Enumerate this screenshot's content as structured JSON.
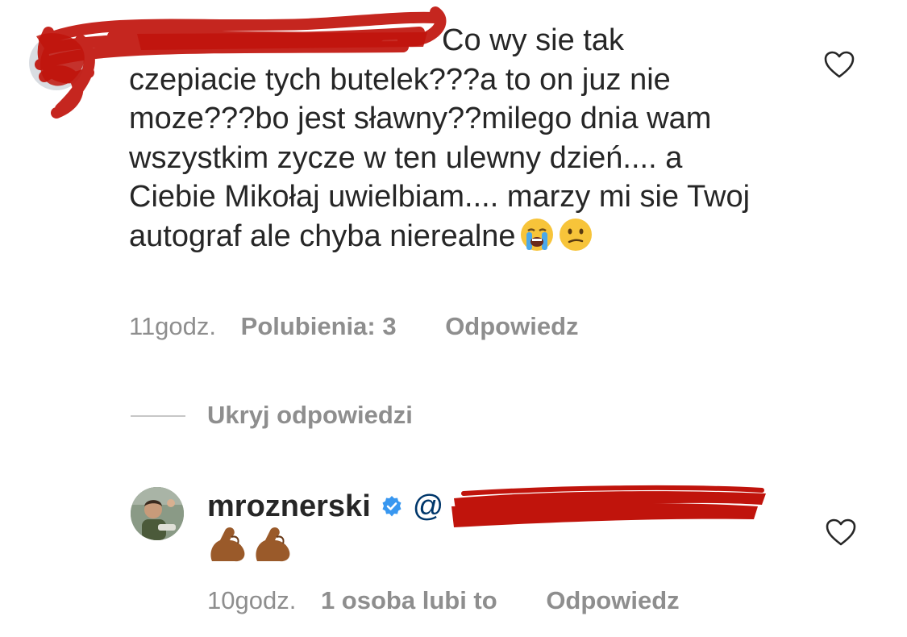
{
  "comment1": {
    "text_first_line": "Co wy sie tak",
    "text_rest": "czepiacie tych butelek???a to on juz nie moze???bo jest sławny??milego dnia wam wszystkim zycze w ten ulewny dzień.... a Ciebie Mikołaj uwielbiam.... marzy mi sie Twoj autograf ale chyba nierealne",
    "emojis": [
      "crying-face",
      "confused-face"
    ],
    "time": "11godz.",
    "likes": "Polubienia: 3",
    "reply_label": "Odpowiedz",
    "redacted": true
  },
  "hide_replies_label": "Ukryj odpowiedzi",
  "comment2": {
    "username": "mroznerski",
    "verified": true,
    "mention_prefix": "@",
    "emojis": [
      "flexed-biceps",
      "flexed-biceps"
    ],
    "time": "10godz.",
    "likes": "1 osoba lubi to",
    "reply_label": "Odpowiedz"
  },
  "icons": {
    "like": "heart-outline-icon",
    "verified": "verified-badge-icon"
  },
  "colors": {
    "text": "#262626",
    "meta": "#8e8e8e",
    "verified": "#3897f0",
    "redaction": "#c0140c",
    "mention": "#00376b"
  }
}
